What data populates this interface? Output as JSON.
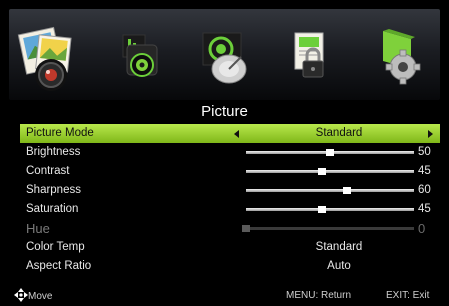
{
  "tabs": [
    {
      "icon": "picture-camera-icon",
      "selected": true
    },
    {
      "icon": "sound-speaker-icon",
      "selected": false
    },
    {
      "icon": "channel-dish-icon",
      "selected": false
    },
    {
      "icon": "lock-icon",
      "selected": false
    },
    {
      "icon": "setup-gear-icon",
      "selected": false
    }
  ],
  "menu": {
    "title": "Picture",
    "rows": [
      {
        "label": "Picture Mode",
        "type": "option",
        "value": "Standard",
        "selected": true
      },
      {
        "label": "Brightness",
        "type": "slider",
        "value": 50
      },
      {
        "label": "Contrast",
        "type": "slider",
        "value": 45
      },
      {
        "label": "Sharpness",
        "type": "slider",
        "value": 60
      },
      {
        "label": "Saturation",
        "type": "slider",
        "value": 45
      },
      {
        "label": "Hue",
        "type": "slider",
        "value": 0,
        "disabled": true
      },
      {
        "label": "Color Temp",
        "type": "option",
        "value": "Standard"
      },
      {
        "label": "Aspect Ratio",
        "type": "option",
        "value": "Auto"
      }
    ]
  },
  "footer": {
    "move": "Move",
    "menu_return": "MENU: Return",
    "exit": "EXIT: Exit"
  },
  "colors": {
    "highlight": "#a6d63a"
  }
}
